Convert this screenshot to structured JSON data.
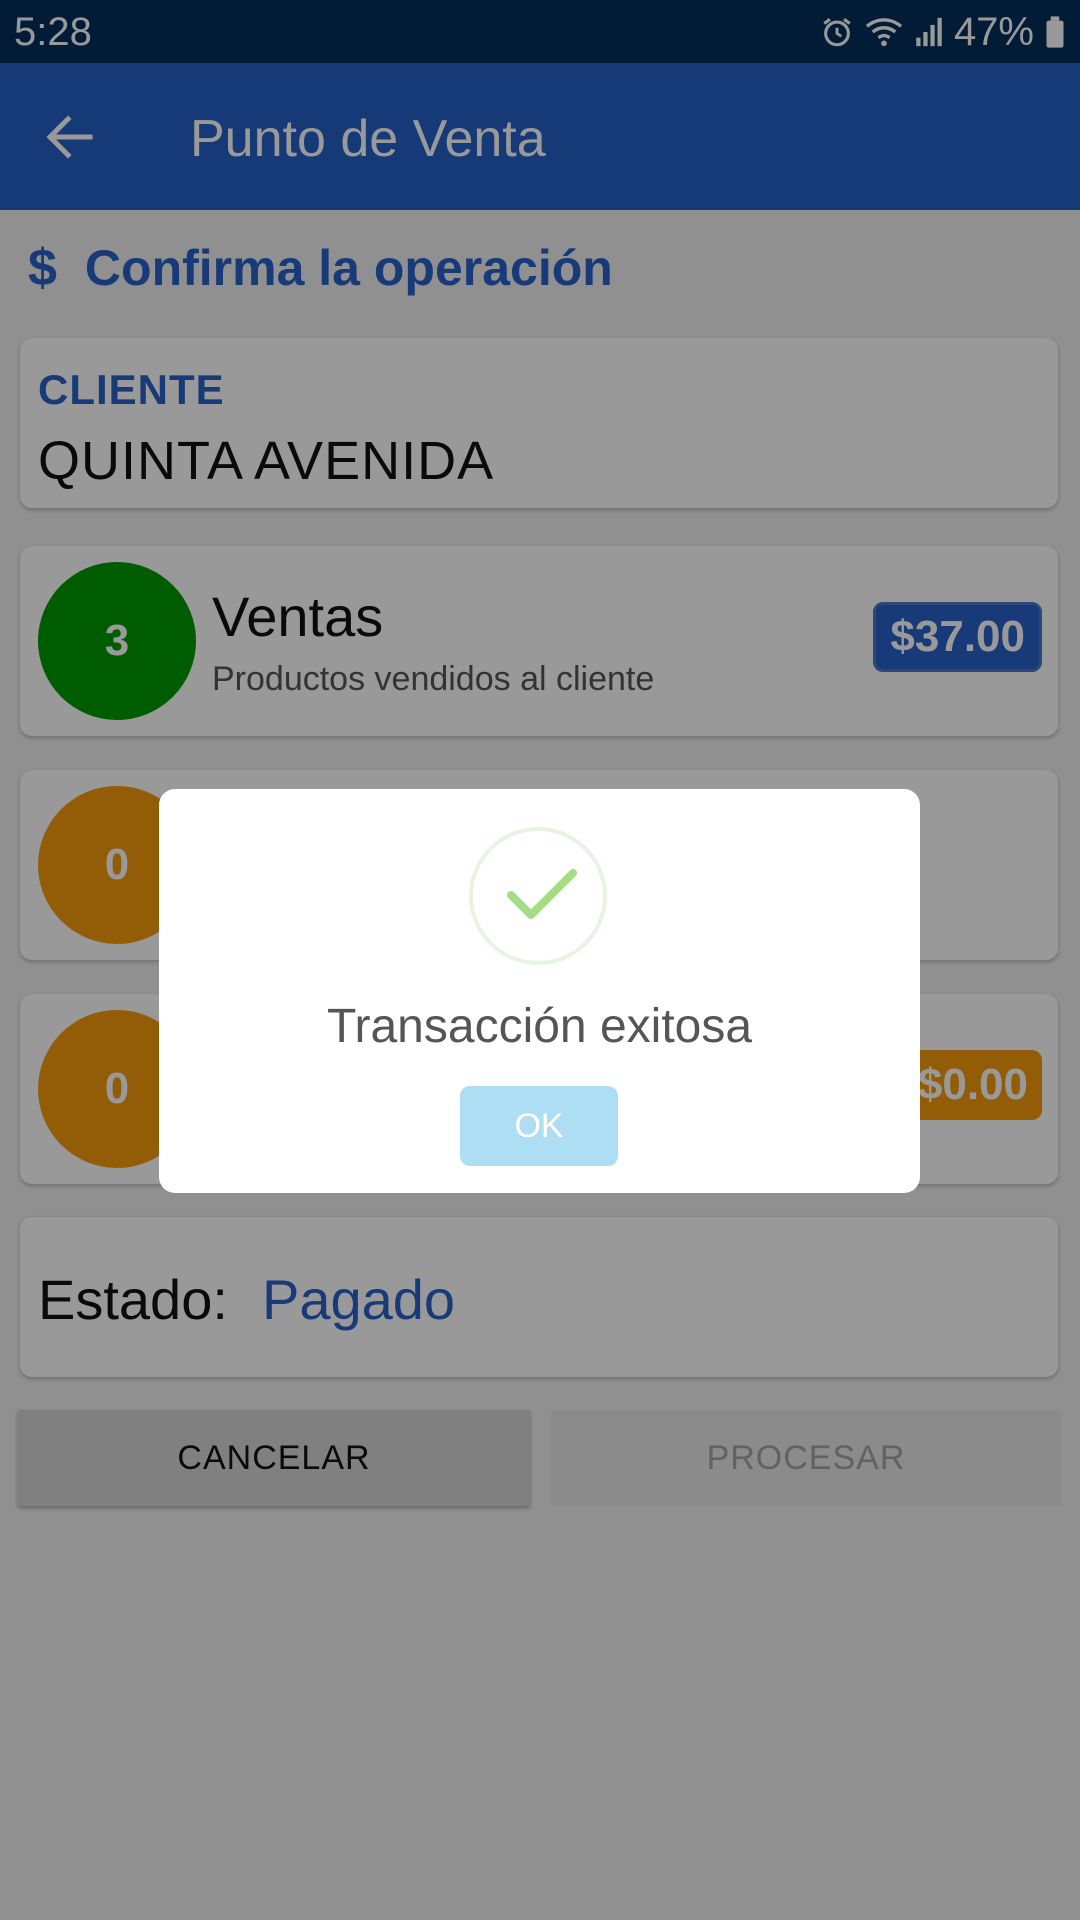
{
  "status_bar": {
    "time": "5:28",
    "battery_percent": "47%",
    "icons": [
      "alarm-icon",
      "wifi-icon",
      "signal-icon",
      "battery-icon"
    ]
  },
  "app_bar": {
    "title": "Punto de Venta",
    "back_icon": "arrow-left-icon",
    "color": "#2560c9"
  },
  "section": {
    "icon": "$",
    "title": "Confirma la operación"
  },
  "client": {
    "label": "CLIENTE",
    "name": "QUINTA AVENIDA"
  },
  "rows": [
    {
      "count": "3",
      "title": "Ventas",
      "subtitle": "Productos vendidos al cliente",
      "amount": "$37.00",
      "circle_color": "#019a02"
    },
    {
      "count": "0",
      "circle_color": "#f39b0a"
    },
    {
      "count": "0",
      "amount": "$0.00",
      "circle_color": "#f39b0a"
    }
  ],
  "estado": {
    "label": "Estado:",
    "value": "Pagado"
  },
  "buttons": {
    "cancel": "CANCELAR",
    "process": "PROCESAR"
  },
  "dialog": {
    "icon": "check-icon",
    "message": "Transacción exitosa",
    "ok_label": "OK"
  }
}
